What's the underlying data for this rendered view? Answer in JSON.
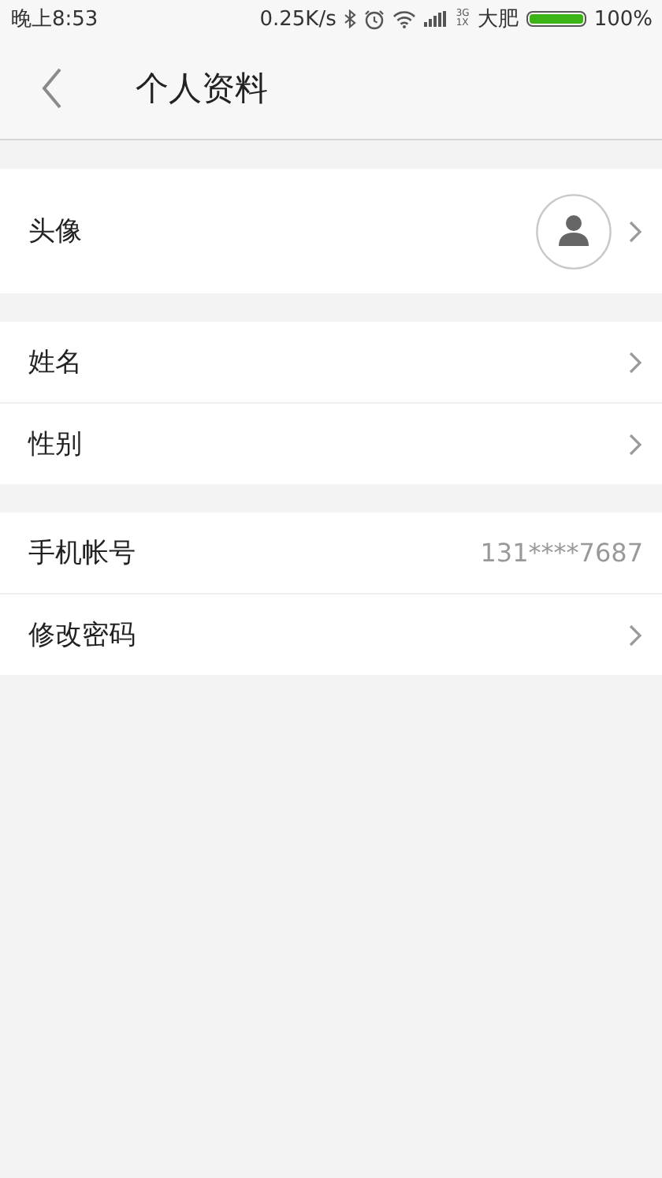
{
  "status_bar": {
    "time": "晚上8:53",
    "speed": "0.25K/s",
    "network_top": "3G",
    "network_bottom": "1X",
    "carrier": "大肥",
    "battery": "100%"
  },
  "header": {
    "title": "个人资料"
  },
  "sections": [
    {
      "rows": [
        {
          "kind": "avatar",
          "label": "头像"
        }
      ]
    },
    {
      "rows": [
        {
          "kind": "link",
          "label": "姓名"
        },
        {
          "kind": "link",
          "label": "性别"
        }
      ]
    },
    {
      "rows": [
        {
          "kind": "value",
          "label": "手机帐号",
          "value": "131****7687"
        },
        {
          "kind": "link",
          "label": "修改密码"
        }
      ]
    }
  ]
}
